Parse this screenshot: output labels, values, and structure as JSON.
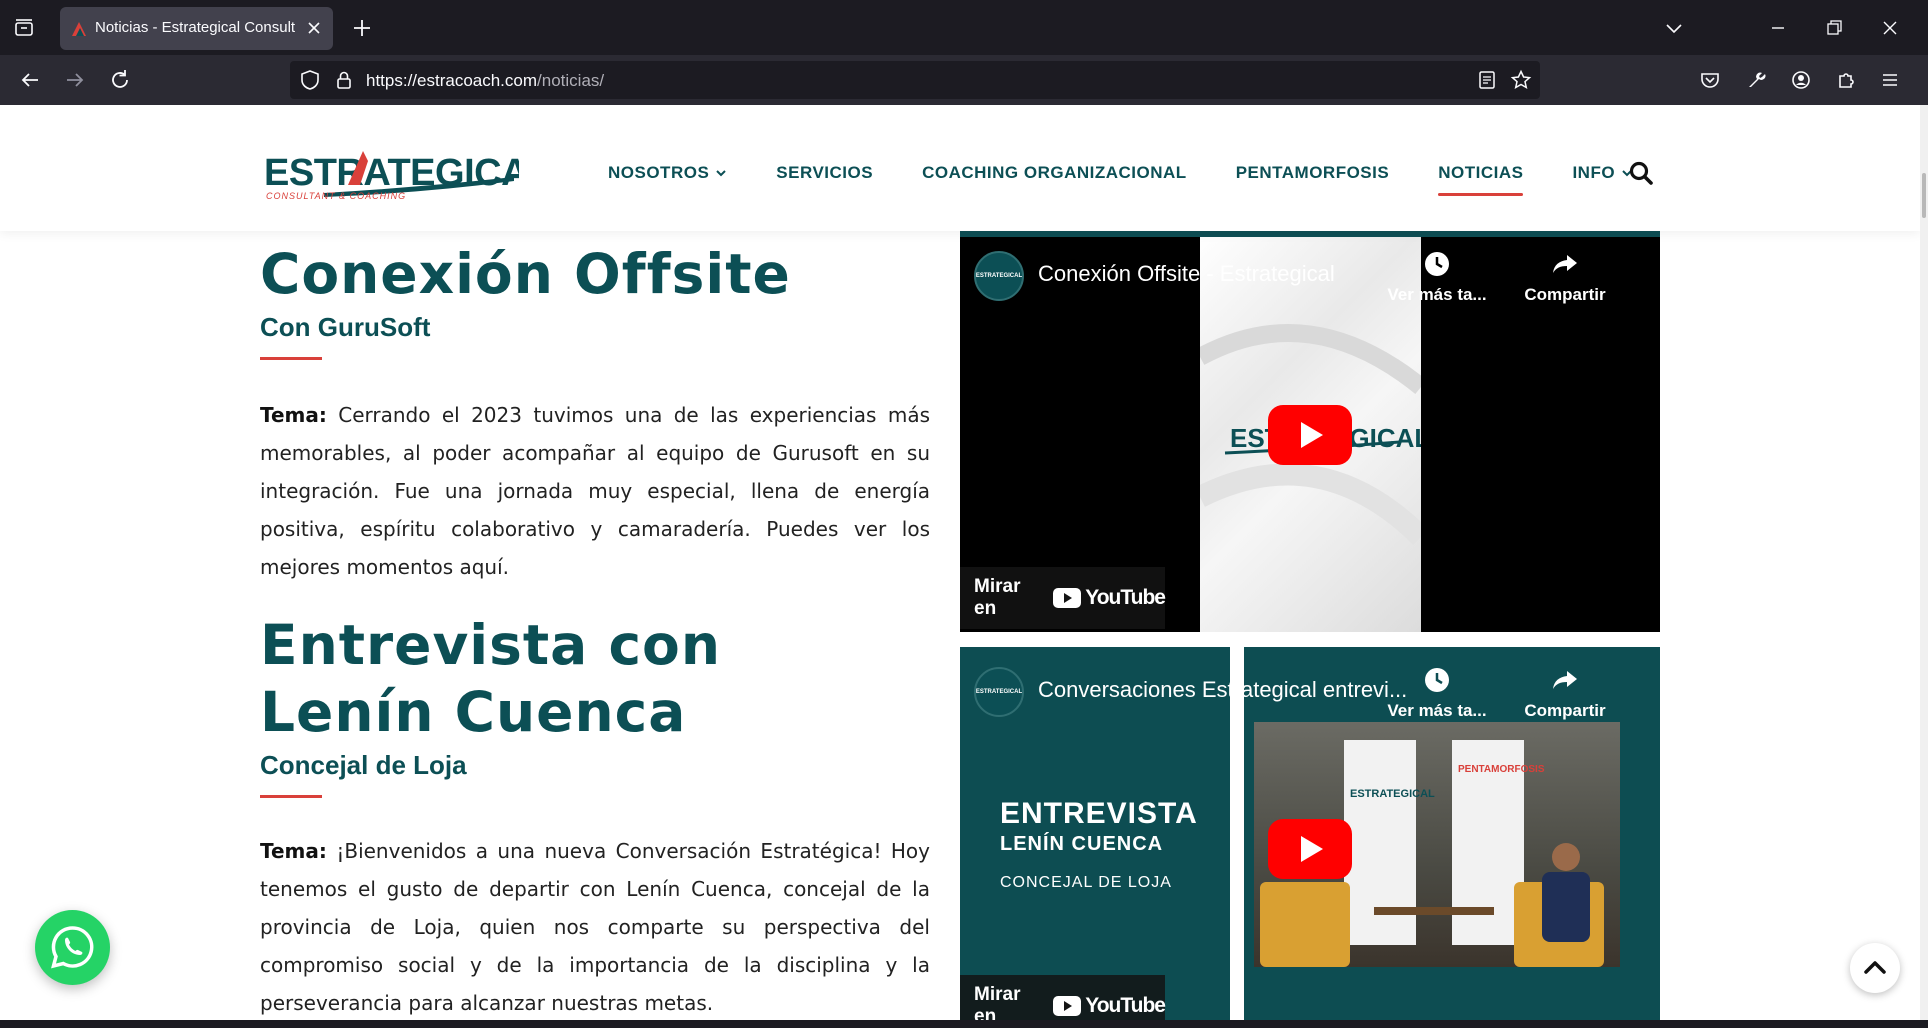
{
  "browser": {
    "tab_title": "Noticias - Estrategical Consultant & Coaching",
    "url_host": "https://estracoach.com",
    "url_path": "/noticias/"
  },
  "site": {
    "logo_main": "ESTRATEGICAL",
    "logo_sub": "CONSULTANT & COACHING",
    "menu": [
      {
        "label": "NOSOTROS",
        "dropdown": true
      },
      {
        "label": "SERVICIOS",
        "dropdown": false
      },
      {
        "label": "COACHING ORGANIZACIONAL",
        "dropdown": false
      },
      {
        "label": "PENTAMORFOSIS",
        "dropdown": false
      },
      {
        "label": "NOTICIAS",
        "dropdown": false,
        "active": true
      },
      {
        "label": "INFO",
        "dropdown": true
      }
    ]
  },
  "articles": [
    {
      "title": "Conexión Offsite",
      "subtitle": "Con GuruSoft",
      "tema_label": "Tema:",
      "body": "Cerrando el 2023 tuvimos una de las experiencias más memorables, al poder acompañar al equipo de Gurusoft en su integración. Fue una jornada muy especial, llena de energía positiva, espíritu colaborativo y camaradería. Puedes ver los mejores momentos aquí."
    },
    {
      "title_line1": "Entrevista con",
      "title_line2": "Lenín Cuenca",
      "subtitle": "Concejal de Loja",
      "tema_label": "Tema:",
      "body": "¡Bienvenidos a una nueva Conversación Estratégica! Hoy tenemos el gusto de departir con Lenín Cuenca, concejal de la provincia de Loja, quien nos comparte su perspectiva del compromiso social y de la importancia de la disciplina y la perseverancia para alcanzar nuestras metas."
    }
  ],
  "videos": [
    {
      "title": "Conexión Offsite - Estrategical",
      "watch_later": "Ver más ta...",
      "share": "Compartir",
      "watch_on": "Mirar en",
      "youtube": "YouTube",
      "thumb_logo": "ESTRATEGICAL"
    },
    {
      "title": "Conversaciones Estrategical entrevi...",
      "watch_later": "Ver más ta...",
      "share": "Compartir",
      "watch_on": "Mirar en",
      "youtube": "YouTube",
      "thumb_heading": "ENTREVISTA",
      "thumb_name": "LENÍN CUENCA",
      "thumb_role": "CONCEJAL DE LOJA"
    }
  ],
  "colors": {
    "brand_teal": "#0c4f55",
    "accent_red": "#d9403a",
    "whatsapp_green": "#25d366",
    "youtube_red": "#ff0000"
  }
}
